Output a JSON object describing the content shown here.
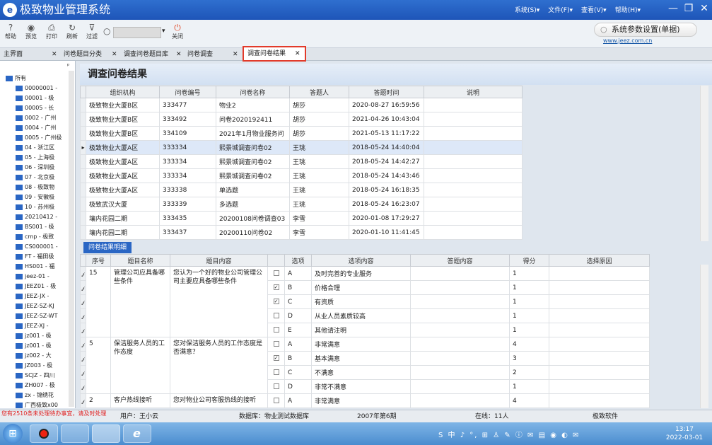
{
  "app": {
    "title": "极致物业管理系统",
    "logo": "e"
  },
  "menu": [
    "系统(S)▾",
    "文件(F)▾",
    "查看(V)▾",
    "帮助(H)▾"
  ],
  "window_controls": {
    "minimize": "—",
    "restore": "❐",
    "close": "✕"
  },
  "toolbar": {
    "buttons": [
      {
        "label": "帮助",
        "icon": "?"
      },
      {
        "label": "预览",
        "icon": "◉"
      },
      {
        "label": "打印",
        "icon": "⎙"
      },
      {
        "label": "刷新",
        "icon": "↻"
      },
      {
        "label": "过滤",
        "icon": "⊽"
      }
    ],
    "search_icon": "○",
    "dropdown_arrow": "▾",
    "close": {
      "label": "关闭",
      "icon": "⏻"
    }
  },
  "system_param": {
    "label": "系统参数设置(单据)",
    "icon": "○"
  },
  "website": "www.jeez.com.cn",
  "tabs": [
    {
      "label": "主界面",
      "close": "✕"
    },
    {
      "label": "问卷题目分类",
      "close": "✕"
    },
    {
      "label": "调查问卷题目库",
      "close": "✕"
    },
    {
      "label": "问卷调查",
      "close": "✕"
    },
    {
      "label": "调查问卷结果",
      "close": "✕"
    }
  ],
  "sidebar": {
    "pin": "ᵖ",
    "root": "所有",
    "items": [
      "00000001 -",
      "00001 - 极",
      "00005 - 长",
      "0002 - 广州",
      "0004 - 广州",
      "0005 - 广州极",
      "04 - 浙江区",
      "05 - 上海极",
      "06 - 深圳极",
      "07 - 北京极",
      "08 - 极致物",
      "09 - 安徽极",
      "10 - 苏州极",
      "20210412 -",
      "BS001 - 极",
      "cmp - 极致",
      "CS000001 -",
      "FT - 福田极",
      "HS001 - 福",
      "jeez-01 -",
      "JEEZ01 - 极",
      "JEEZ-JX -",
      "JEEZ-SZ-KJ",
      "JEEZ-SZ-WT",
      "JEEZ-XJ -",
      "jz001 - 极",
      "jz001 - 极",
      "jz002 - 大",
      "JZ003 - 极",
      "SCJZ - 四川",
      "ZH007 - 极",
      "zx - 锦绣花",
      "广西极致x00"
    ]
  },
  "page_title": "调查问卷结果",
  "results": {
    "columns": [
      "组织机构",
      "问卷编号",
      "问卷名称",
      "答题人",
      "答题时间",
      "说明"
    ],
    "rows": [
      [
        "极致物业大厦B区",
        "333477",
        "物业2",
        "胡莎",
        "2020-08-27 16:59:56",
        ""
      ],
      [
        "极致物业大厦B区",
        "333492",
        "问卷2020192411",
        "胡莎",
        "2021-04-26 10:43:04",
        ""
      ],
      [
        "极致物业大厦B区",
        "334109",
        "2021年1月物业服务问",
        "胡莎",
        "2021-05-13 11:17:22",
        ""
      ],
      [
        "极致物业大厦A区",
        "333334",
        "熙景城调查问卷02",
        "王珧",
        "2018-05-24 14:40:04",
        ""
      ],
      [
        "极致物业大厦A区",
        "333334",
        "熙景城调查问卷02",
        "王珧",
        "2018-05-24 14:42:27",
        ""
      ],
      [
        "极致物业大厦A区",
        "333334",
        "熙景城调查问卷02",
        "王珧",
        "2018-05-24 14:43:46",
        ""
      ],
      [
        "极致物业大厦A区",
        "333338",
        "单选题",
        "王珧",
        "2018-05-24 16:18:35",
        ""
      ],
      [
        "极致武汉大厦",
        "333339",
        "多选题",
        "王珧",
        "2018-05-24 16:23:07",
        ""
      ],
      [
        "壤内花园二期",
        "333435",
        "20200108问卷调查03",
        "李雪",
        "2020-01-08 17:29:27",
        ""
      ],
      [
        "壤内花园二期",
        "333437",
        "20200110问卷02",
        "李雪",
        "2020-01-10 11:41:45",
        ""
      ]
    ],
    "selected_index": 3,
    "row_marker": "▸"
  },
  "detail_tab": "问卷结果明细",
  "detail": {
    "columns": [
      "序号",
      "题目名称",
      "题目内容",
      "",
      "选项",
      "选项内容",
      "答题内容",
      "得分",
      "选择原因"
    ],
    "edit_marker": "𝒿",
    "groups": [
      {
        "no": "15",
        "name": "管理公司应具备哪些条件",
        "content": "您认为一个好的物业公司管理公司主要应具备哪些条件",
        "options": [
          {
            "checked": false,
            "opt": "A",
            "text": "及时完善的专业服务",
            "answer": "",
            "score": "1"
          },
          {
            "checked": true,
            "opt": "B",
            "text": "价格合理",
            "answer": "",
            "score": "1"
          },
          {
            "checked": true,
            "opt": "C",
            "text": "有资质",
            "answer": "",
            "score": "1"
          },
          {
            "checked": false,
            "opt": "D",
            "text": "从业人员素质较高",
            "answer": "",
            "score": "1"
          },
          {
            "checked": false,
            "opt": "E",
            "text": "其他请注明",
            "answer": "",
            "score": "1"
          }
        ]
      },
      {
        "no": "5",
        "name": "保洁服务人员的工作态度",
        "content": "您对保洁服务人员的工作态度是否满意？",
        "options": [
          {
            "checked": false,
            "opt": "A",
            "text": "非常满意",
            "answer": "",
            "score": "4"
          },
          {
            "checked": true,
            "opt": "B",
            "text": "基本满意",
            "answer": "",
            "score": "3"
          },
          {
            "checked": false,
            "opt": "C",
            "text": "不满意",
            "answer": "",
            "score": "2"
          },
          {
            "checked": false,
            "opt": "D",
            "text": "非常不满意",
            "answer": "",
            "score": "1"
          }
        ]
      },
      {
        "no": "2",
        "name": "客户热线接听",
        "content": "您对物业公司客服热线的接听",
        "options": [
          {
            "checked": false,
            "opt": "A",
            "text": "非常满意",
            "answer": "",
            "score": "4"
          }
        ]
      }
    ]
  },
  "status": {
    "notice": "您有2510条未处理待办事宜，请及时处理",
    "user": "用户：王小云",
    "database": "数据库：物业测试数据库",
    "period": "2007年第6期",
    "online": "在线：11人",
    "company": "极致软件"
  },
  "taskbar": {
    "start_icon": "⊞",
    "tray": "S 中 ♪ °, ⊞ ♙ ✎ ⓘ ✉ ▤ ◉ ◐ ✉",
    "time": "13:17",
    "date": "2022-03-01"
  }
}
